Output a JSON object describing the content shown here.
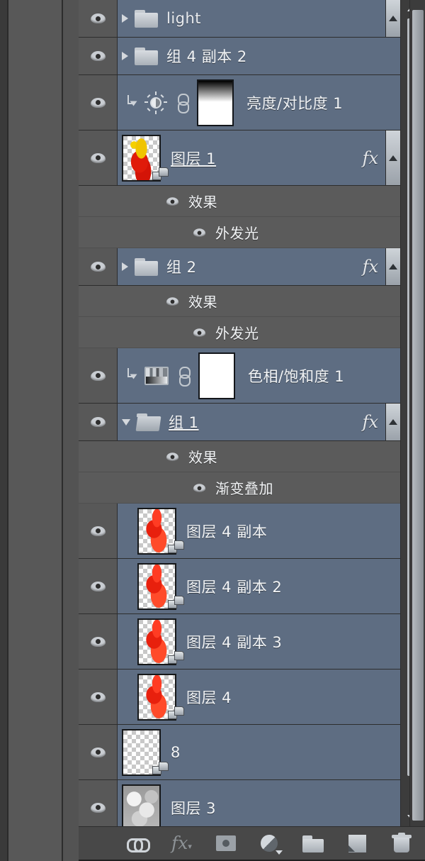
{
  "panel": {
    "title": "Layers",
    "background_color": "#535353",
    "selected_row_color": "#5e6d82",
    "effects_row_color": "#5b5b5b"
  },
  "layers": [
    {
      "name": "light",
      "type": "group",
      "expanded": false,
      "visible": true,
      "selected": true,
      "has_fx": false
    },
    {
      "name": "组 4 副本 2",
      "type": "group",
      "expanded": false,
      "visible": true,
      "selected": true,
      "has_fx": false
    },
    {
      "name": "亮度/对比度 1",
      "type": "adjustment",
      "adjustment_icon": "brightness-contrast-icon",
      "clipped": true,
      "linked": true,
      "visible": true,
      "selected": true,
      "has_fx": false
    },
    {
      "name": "图层 1",
      "type": "pixel",
      "thumbnail": "red-gold-characters",
      "visible": true,
      "selected": true,
      "has_fx": true,
      "effects_label": "效果",
      "effects": [
        "外发光"
      ]
    },
    {
      "name": "组 2",
      "type": "group",
      "expanded": false,
      "visible": true,
      "selected": true,
      "has_fx": true,
      "effects_label": "效果",
      "effects": [
        "外发光"
      ]
    },
    {
      "name": "色相/饱和度 1",
      "type": "adjustment",
      "adjustment_icon": "hue-saturation-icon",
      "clipped": true,
      "linked": true,
      "visible": true,
      "selected": true,
      "has_fx": false
    },
    {
      "name": "组 1",
      "type": "group",
      "expanded": true,
      "visible": true,
      "selected": true,
      "has_fx": true,
      "effects_label": "效果",
      "effects": [
        "渐变叠加"
      ]
    },
    {
      "name": "图层 4 副本",
      "type": "pixel",
      "thumbnail": "red-tree",
      "visible": true,
      "selected": true,
      "has_fx": false
    },
    {
      "name": "图层 4 副本 2",
      "type": "pixel",
      "thumbnail": "red-tree",
      "visible": true,
      "selected": true,
      "has_fx": false
    },
    {
      "name": "图层 4 副本 3",
      "type": "pixel",
      "thumbnail": "red-tree",
      "visible": true,
      "selected": true,
      "has_fx": false
    },
    {
      "name": "图层 4",
      "type": "pixel",
      "thumbnail": "red-tree",
      "visible": true,
      "selected": true,
      "has_fx": false
    },
    {
      "name": "8",
      "type": "pixel",
      "thumbnail": "transparent-empty",
      "visible": true,
      "selected": true,
      "has_fx": false
    },
    {
      "name": "图层 3",
      "type": "pixel",
      "thumbnail": "gray-clouds",
      "visible": true,
      "selected": true,
      "has_fx": false
    },
    {
      "name": "",
      "type": "pixel",
      "thumbnail": "orange-fill",
      "visible": true,
      "selected": true,
      "has_fx": false,
      "partial": true
    }
  ],
  "toolbar": {
    "items": [
      {
        "icon": "link-layers-icon",
        "label": "链接图层"
      },
      {
        "icon": "add-layer-style-icon",
        "label": "添加图层样式"
      },
      {
        "icon": "add-layer-mask-icon",
        "label": "添加图层蒙版"
      },
      {
        "icon": "new-adjustment-icon",
        "label": "创建新的填充或调整图层"
      },
      {
        "icon": "new-group-icon",
        "label": "创建新组"
      },
      {
        "icon": "new-layer-icon",
        "label": "创建新图层"
      },
      {
        "icon": "delete-layer-icon",
        "label": "删除图层"
      }
    ]
  },
  "scrollbars": {
    "inner_up_arrow": "scroll-up-arrow",
    "inner_down_arrow": "scroll-down-arrow"
  }
}
